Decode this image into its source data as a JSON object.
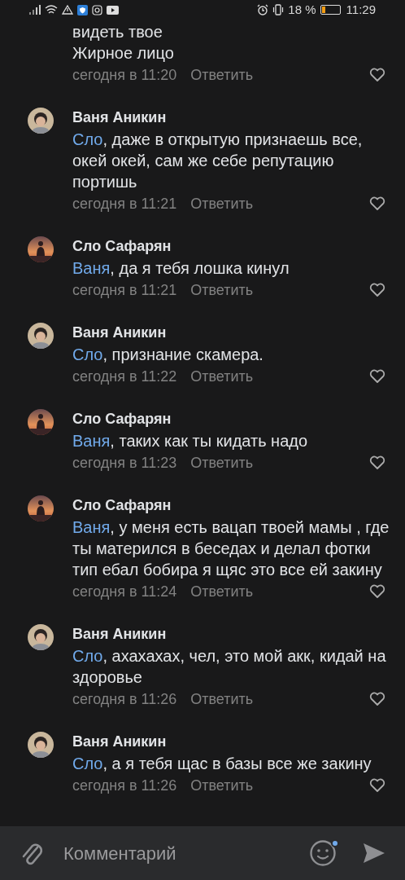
{
  "status_bar": {
    "battery_text": "18 %",
    "time": "11:29"
  },
  "comments": [
    {
      "kind": "clipped",
      "lines": [
        "видеть твое",
        "Жирное лицо"
      ],
      "time": "сегодня в 11:20",
      "reply": "Ответить"
    },
    {
      "kind": "portrait",
      "author": "Ваня Аникин",
      "mention": "Сло",
      "text": ", даже в открытую признаешь все, окей окей, сам же себе репутацию портишь",
      "time": "сегодня в 11:21",
      "reply": "Ответить"
    },
    {
      "kind": "sunset",
      "author": "Сло Сафарян",
      "mention": "Ваня",
      "text": ", да я тебя лошка кинул",
      "time": "сегодня в 11:21",
      "reply": "Ответить"
    },
    {
      "kind": "portrait",
      "author": "Ваня Аникин",
      "mention": "Сло",
      "text": ", признание скамера.",
      "time": "сегодня в 11:22",
      "reply": "Ответить"
    },
    {
      "kind": "sunset",
      "author": "Сло Сафарян",
      "mention": "Ваня",
      "text": ", таких как ты кидать надо",
      "time": "сегодня в 11:23",
      "reply": "Ответить"
    },
    {
      "kind": "sunset",
      "author": "Сло Сафарян",
      "mention": "Ваня",
      "text": ", у меня есть вацап твоей мамы , где ты матерился в беседах и делал фотки тип ебал бобира я щяс это все ей закину",
      "time": "сегодня в 11:24",
      "reply": "Ответить"
    },
    {
      "kind": "portrait",
      "author": "Ваня Аникин",
      "mention": "Сло",
      "text": ", ахахахах, чел, это мой акк, кидай на здоровье",
      "time": "сегодня в 11:26",
      "reply": "Ответить"
    },
    {
      "kind": "portrait",
      "author": "Ваня Аникин",
      "mention": "Сло",
      "text": ", а я тебя щас в базы все же закину",
      "time": "сегодня в 11:26",
      "reply": "Ответить"
    }
  ],
  "composer": {
    "placeholder": "Комментарий",
    "emoji_badge": true
  }
}
